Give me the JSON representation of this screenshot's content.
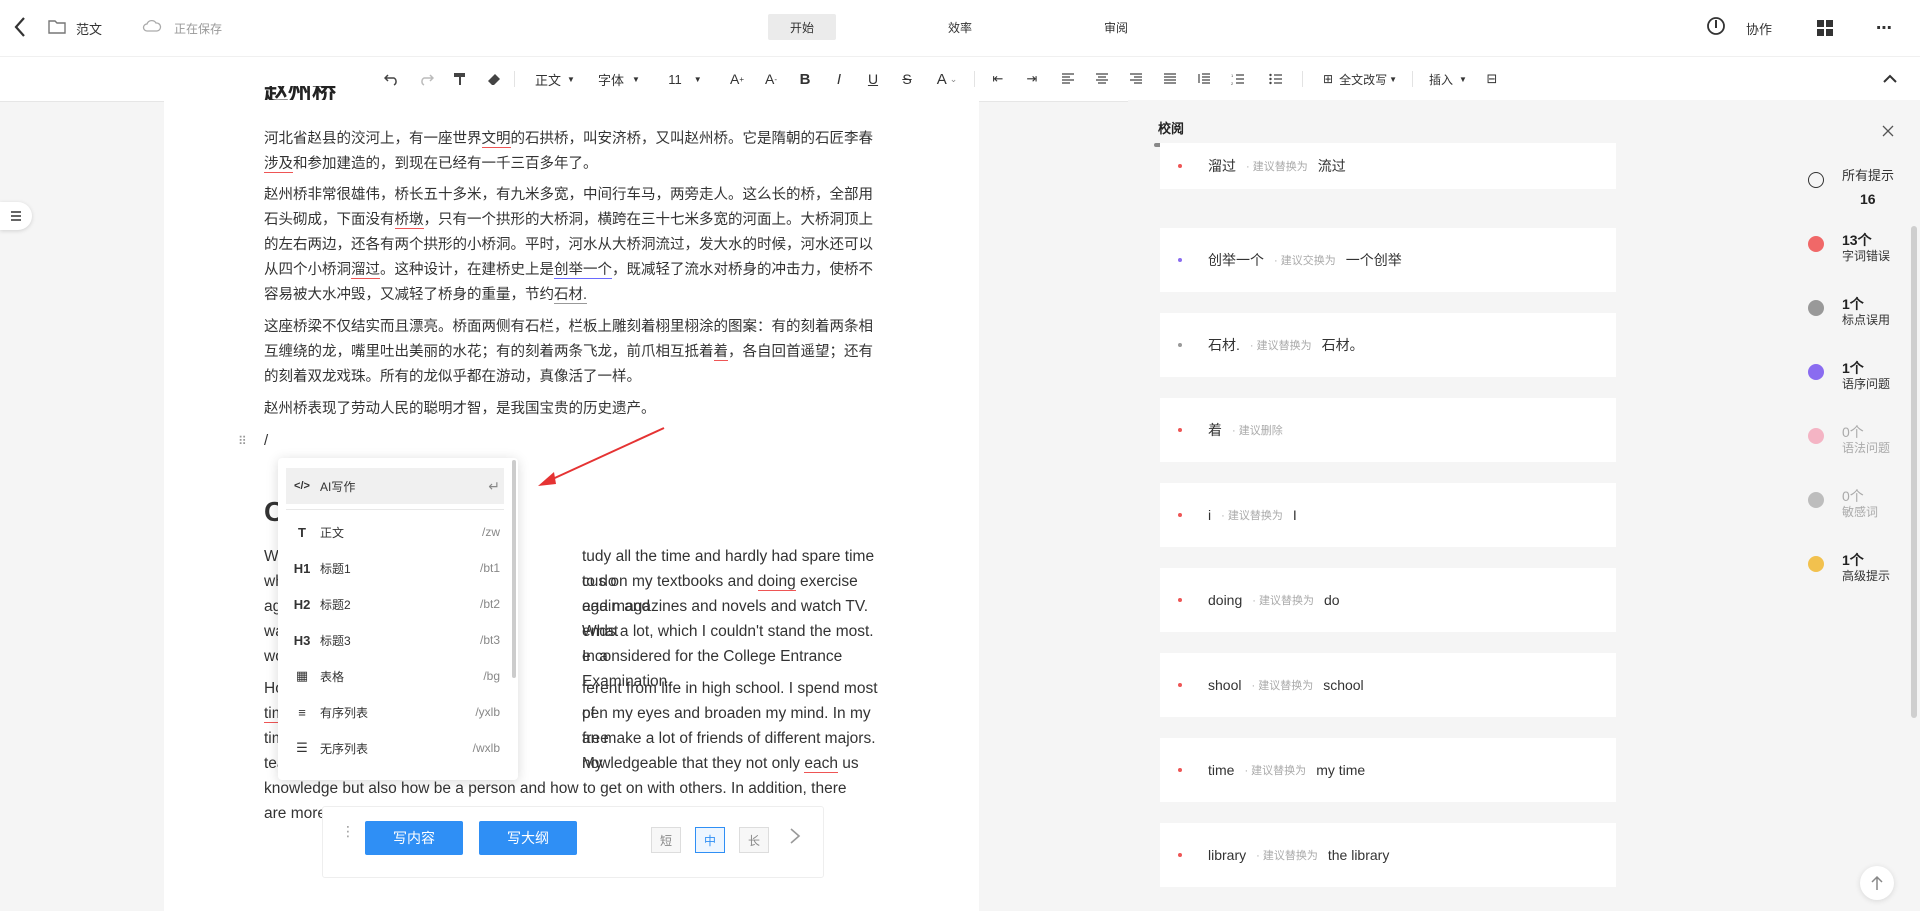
{
  "header": {
    "doc_title": "范文",
    "save_status": "正在保存",
    "tabs": [
      "开始",
      "效率",
      "审阅"
    ],
    "collab_label": "协作"
  },
  "toolbar": {
    "style_select": "正文",
    "font_select": "字体",
    "size_select": "11",
    "rewrite_label": "全文改写",
    "insert_label": "插入"
  },
  "doc": {
    "heading_partial": "赵州桥",
    "p1_a": "河北省赵县的洨河上，有一座世界",
    "p1_err1": "文明",
    "p1_b": "的石拱桥，叫安济桥，又叫赵州桥。它是隋朝的石匠李春",
    "p1_err2": "涉及",
    "p1_c": "和参加建造的，到现在已经有一千三百多年了。",
    "p2_a": "赵州桥非常很雄伟，桥长五十多米，有九米多宽，中间行车马，两旁走人。这么长的桥，全部用石头砌成，下面没有",
    "p2_err1": "桥墩",
    "p2_b": "，只有一个拱形的大桥洞，横跨在三十七米多宽的河面上。大桥洞顶上的左右两边，还各有两个拱形的小桥洞。平时，河水从大桥洞流过，发大水的时候，河水还可以从四个小桥洞",
    "p2_err2": "溜过",
    "p2_c": "。这种设计，在建桥史上是",
    "p2_err3": "创举一个",
    "p2_d": "，既减轻了流水对桥身的冲击力，使桥不容易被大水冲毁，又减轻了桥身的重量，节约",
    "p2_err4": "石材.",
    "p3_a": "这座桥梁不仅结实而且漂亮。桥面两侧有石栏，栏板上雕刻着栩里栩涂的图案：有的刻着两条相互缠绕的龙，嘴里吐出美丽的水花；有的刻着两条飞龙，前爪相互抵着",
    "p3_err": "着",
    "p3_b": "，各自回首遥望；还有的刻着双龙戏珠。所有的龙似乎都在游动，真像活了一样。",
    "p4": "赵州桥表现了劳动人民的聪明才智，是我国宝贵的历史遗产。",
    "slash": "/",
    "heading2_partial": "C",
    "e1_l1a": "W",
    "e1_l1b": "tudy all the time and hardly had spare time to do",
    "e1_l2a": "wh",
    "e1_l2b": "cus on my textbooks and ",
    "e1_l2err": "doing",
    "e1_l2c": " exercise again and",
    "e1_l3a": "ag",
    "e1_l3b": "ead magazines and novels and watch TV. What",
    "e1_l4a": "wa",
    "e1_l4b": "ends a lot, which I couldn't stand the most. In a",
    "e1_l5a": "wo",
    "e1_l5b": "e considered for the College Entrance Examination.",
    "e2_l1a": "Ho",
    "e2_l1b": "ferent from life in high school. I spend most of",
    "e2_l2a": "tim",
    "e2_l2b": "pen my eyes and broaden my mind. In my free",
    "e2_l3a": "tim",
    "e2_l3b": "an make a lot of friends of different majors. My",
    "e2_l4a": "tea",
    "e2_l4b": "nowledgeable that they not only ",
    "e2_l4err": "each",
    "e2_l4c": " us",
    "e2_l5": "knowledge but also how be a person and how to get on with others. In addition, there",
    "e2_l6": "are more"
  },
  "slash_menu": {
    "ai_label": "AI写作",
    "items": [
      {
        "icon": "T",
        "label": "正文",
        "shortcut": "/zw"
      },
      {
        "icon": "H1",
        "label": "标题1",
        "shortcut": "/bt1"
      },
      {
        "icon": "H2",
        "label": "标题2",
        "shortcut": "/bt2"
      },
      {
        "icon": "H3",
        "label": "标题3",
        "shortcut": "/bt3"
      },
      {
        "icon": "▦",
        "label": "表格",
        "shortcut": "/bg"
      },
      {
        "icon": "≡",
        "label": "有序列表",
        "shortcut": "/yxlb"
      },
      {
        "icon": "☰",
        "label": "无序列表",
        "shortcut": "/wxlb"
      }
    ]
  },
  "ai_bar": {
    "write_content": "写内容",
    "write_outline": "写大纲",
    "short": "短",
    "medium": "中",
    "long": "长"
  },
  "review": {
    "tab_label": "校阅",
    "cards": [
      {
        "word": "溜过",
        "hint": "· 建议替换为",
        "fix": "流过",
        "color": "#e55"
      },
      {
        "word": "创举一个",
        "hint": "· 建议交换为",
        "fix": "一个创举",
        "color": "#8a6cf0"
      },
      {
        "word": "石材.",
        "hint": "· 建议替换为",
        "fix": "石材。",
        "color": "#999"
      },
      {
        "word": "着",
        "hint": "· 建议删除",
        "fix": "",
        "color": "#e55"
      },
      {
        "word": "i",
        "hint": "· 建议替换为",
        "fix": "I",
        "color": "#e55"
      },
      {
        "word": "doing",
        "hint": "· 建议替换为",
        "fix": "do",
        "color": "#e55"
      },
      {
        "word": "shool",
        "hint": "· 建议替换为",
        "fix": "school",
        "color": "#e55"
      },
      {
        "word": "time",
        "hint": "· 建议替换为",
        "fix": "my time",
        "color": "#e55"
      },
      {
        "word": "library",
        "hint": "· 建议替换为",
        "fix": "the library",
        "color": "#e55"
      }
    ],
    "all_label": "所有提示",
    "all_count": "16",
    "categories": [
      {
        "num": "13个",
        "label": "字词错误",
        "color": "#f06868"
      },
      {
        "num": "1个",
        "label": "标点误用",
        "color": "#999999"
      },
      {
        "num": "1个",
        "label": "语序问题",
        "color": "#8a6cf0"
      },
      {
        "num": "0个",
        "label": "语法问题",
        "color": "#f4b4c4"
      },
      {
        "num": "0个",
        "label": "敏感词",
        "color": "#bdbdbd"
      },
      {
        "num": "1个",
        "label": "高级提示",
        "color": "#f2c14e"
      }
    ]
  }
}
